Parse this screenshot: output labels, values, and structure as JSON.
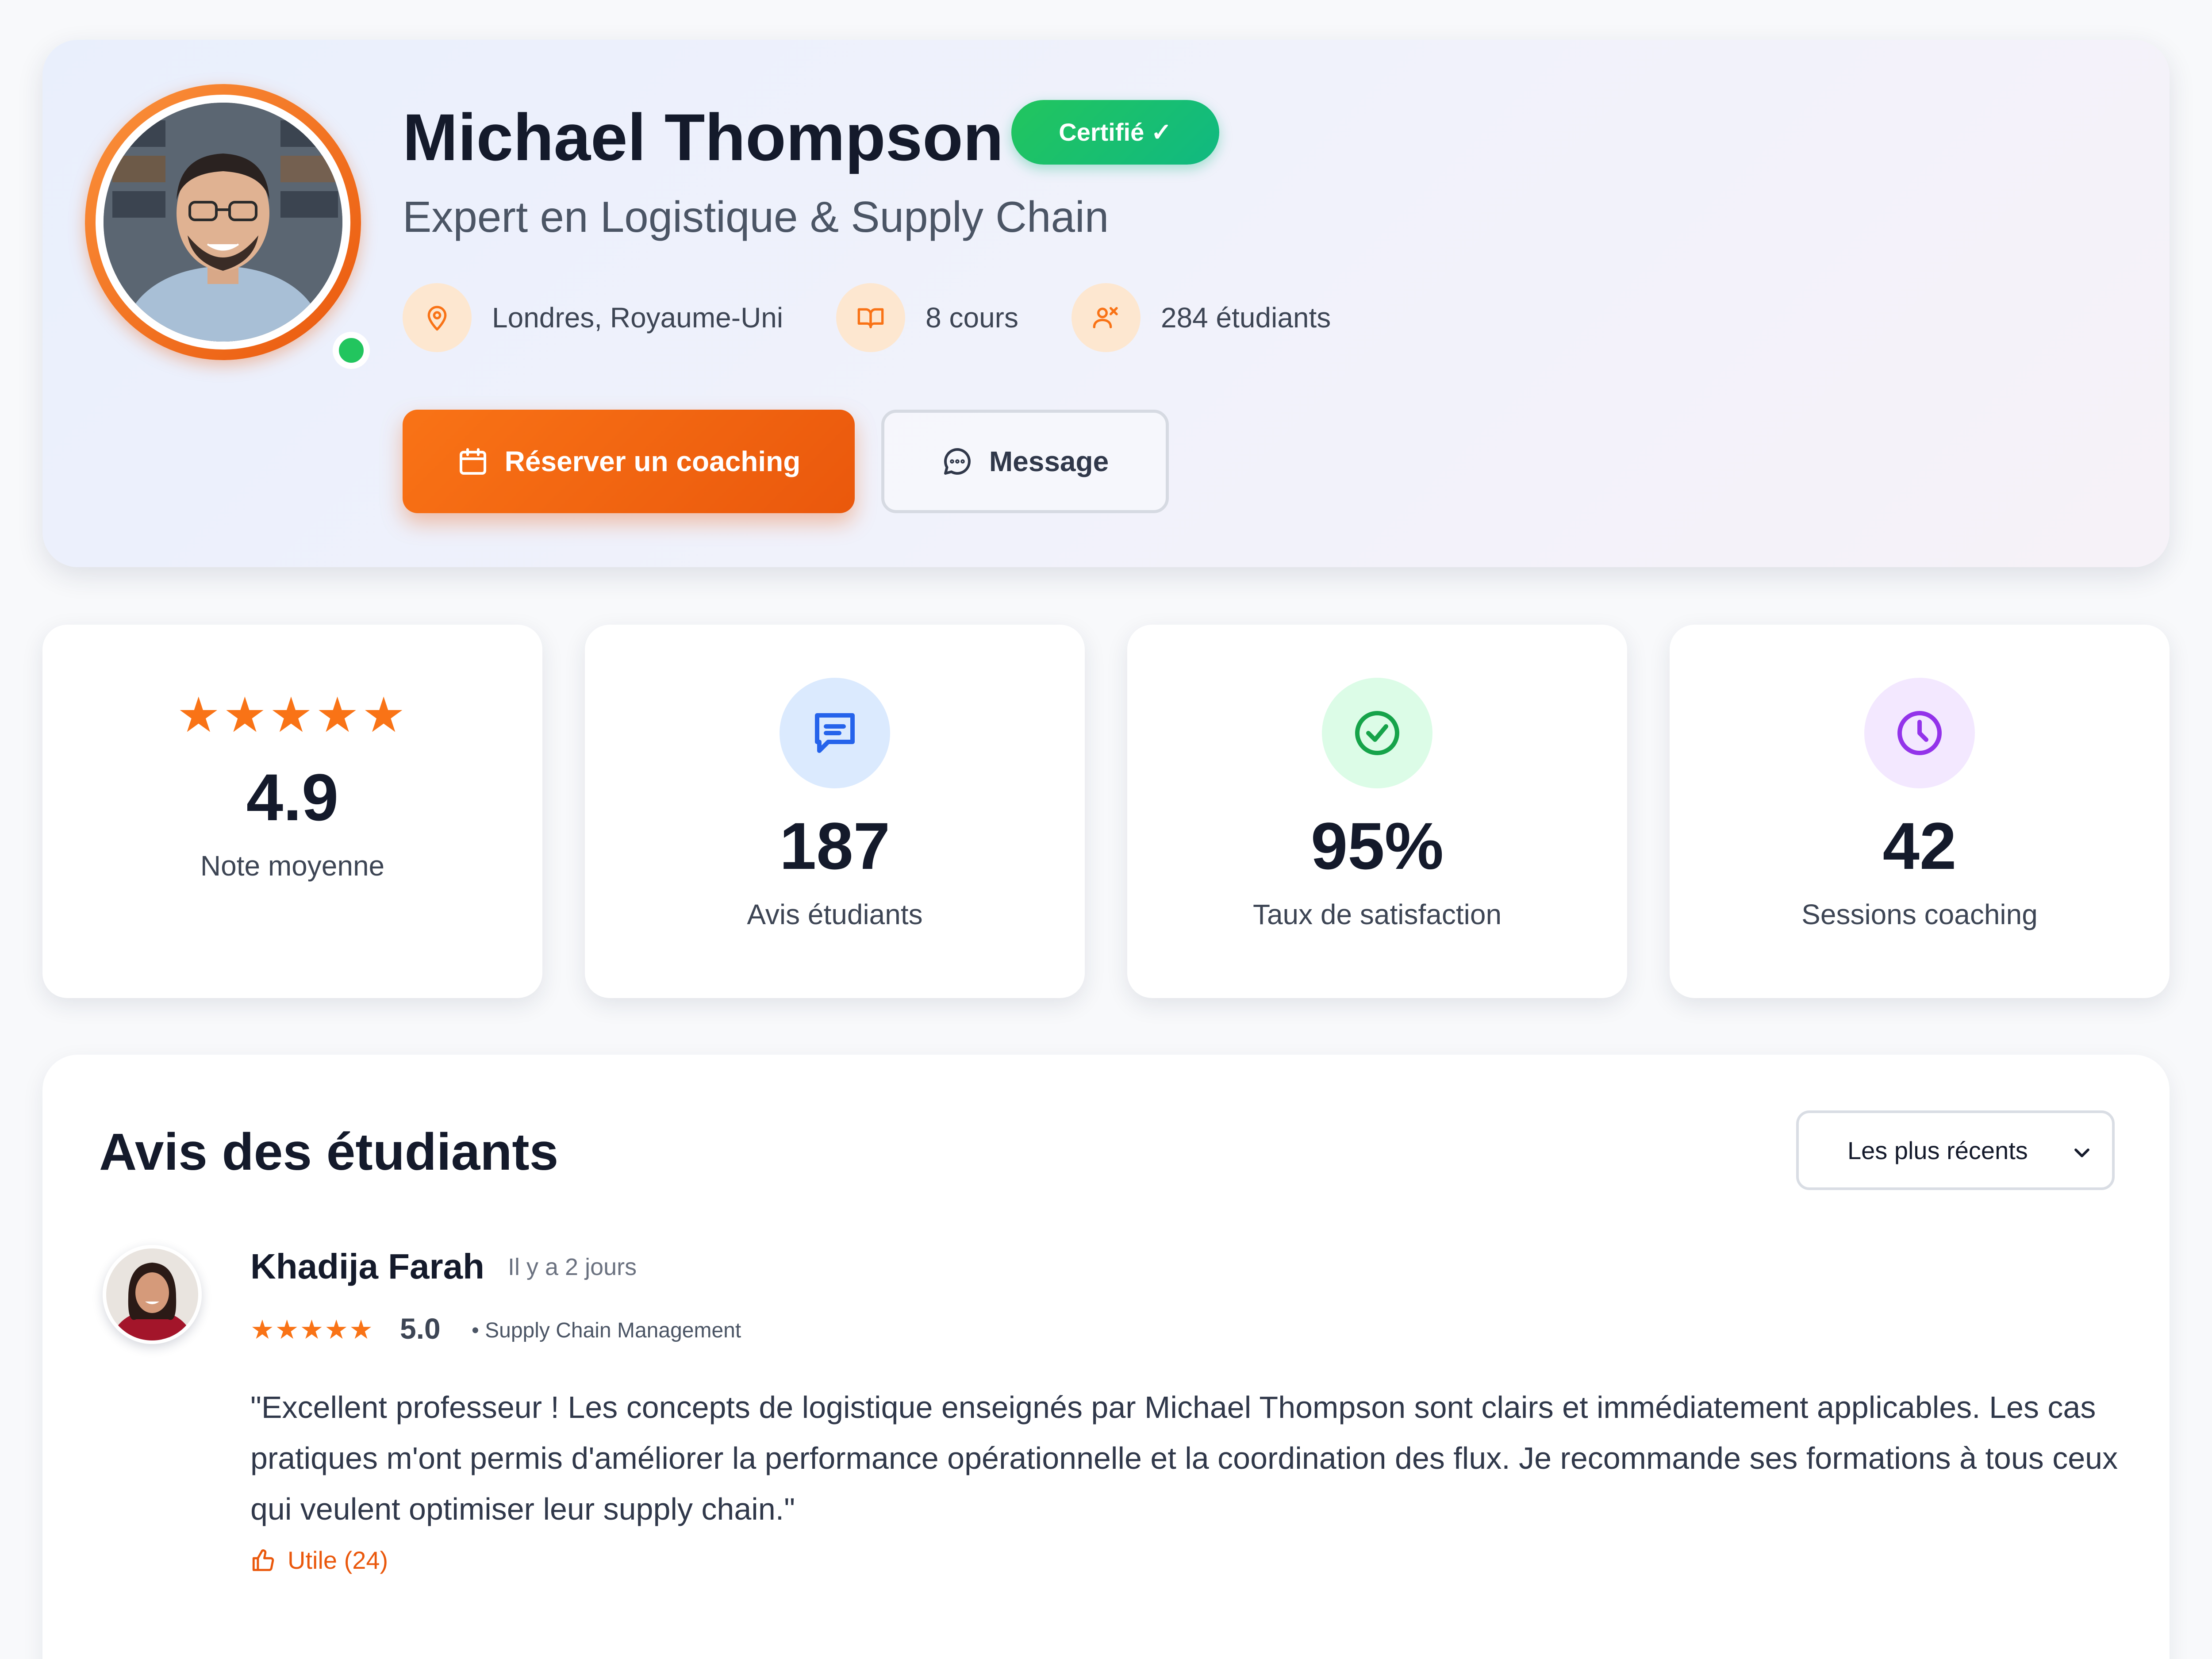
{
  "profile": {
    "name": "Michael Thompson",
    "badge": "Certifié ✓",
    "subtitle": "Expert en Logistique & Supply Chain",
    "location": "Londres, Royaume-Uni",
    "courses": "8 cours",
    "students": "284 étudiants",
    "status": "online",
    "book_button": "Réserver un coaching",
    "message_button": "Message"
  },
  "stats": [
    {
      "stars": "★★★★★",
      "value": "4.9",
      "label": "Note moyenne",
      "icon": "stars"
    },
    {
      "value": "187",
      "label": "Avis étudiants",
      "icon": "chat-icon"
    },
    {
      "value": "95%",
      "label": "Taux de satisfaction",
      "icon": "check-circle-icon"
    },
    {
      "value": "42",
      "label": "Sessions coaching",
      "icon": "clock-icon"
    }
  ],
  "reviews": {
    "title": "Avis des étudiants",
    "sort_selected": "Les plus récents",
    "items": [
      {
        "name": "Khadija Farah",
        "time": "Il y a 2 jours",
        "stars": "★★★★★",
        "score": "5.0",
        "course": "• Supply Chain Management",
        "text": "\"Excellent professeur ! Les concepts de logistique enseignés par Michael Thompson sont clairs et immédiatement applicables. Les cas pratiques m'ont permis d'améliorer la performance opérationnelle et la coordination des flux. Je recommande ses formations à tous ceux qui veulent optimiser leur supply chain.\"",
        "helpful": "Utile (24)"
      }
    ]
  },
  "colors": {
    "accent": "#f97316",
    "accent_dark": "#ea580c",
    "success": "#22c55e",
    "blue_bg": "#dbeafe",
    "green_bg": "#dcfce7",
    "purple_bg": "#f3e8ff"
  }
}
